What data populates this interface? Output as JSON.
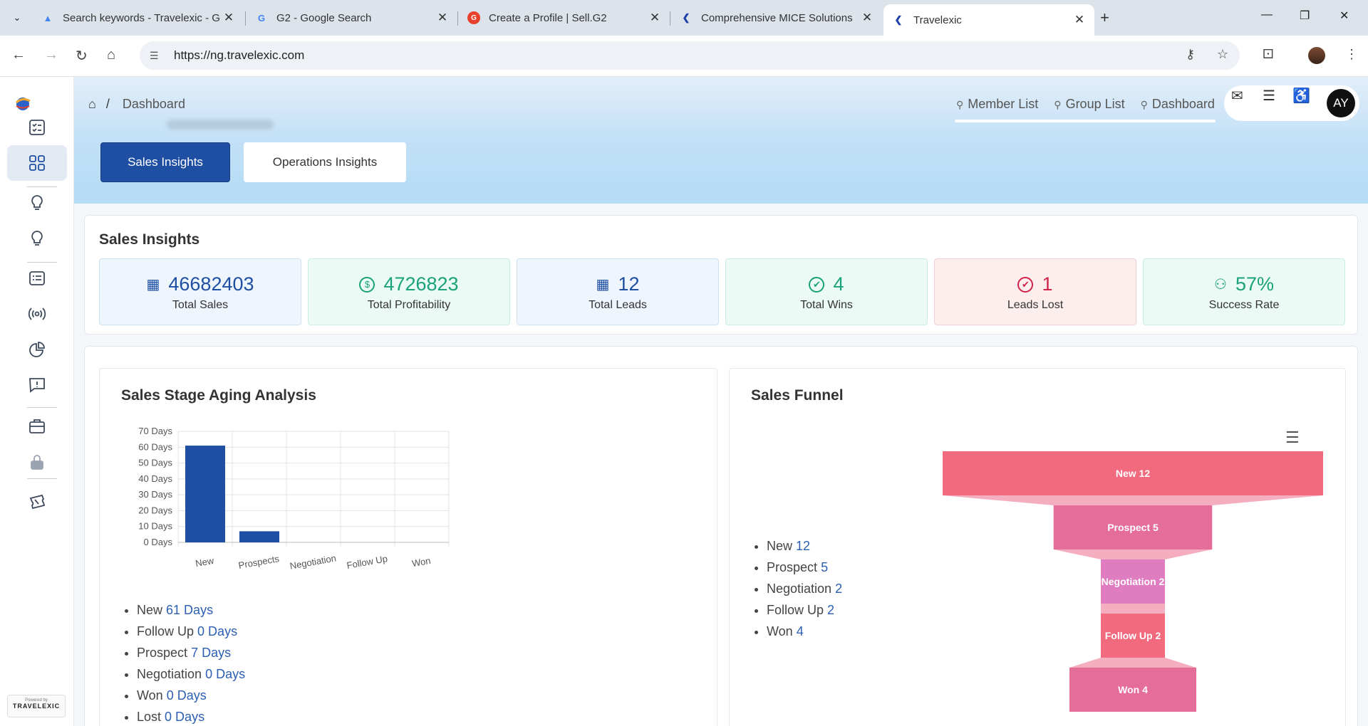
{
  "browser": {
    "tabs": [
      {
        "title": "Search keywords - Travelexic - G",
        "favicon": "google-ads-icon",
        "color": "#4285f4"
      },
      {
        "title": "G2 - Google Search",
        "favicon": "google-icon",
        "color": "#4285f4"
      },
      {
        "title": "Create a Profile | Sell.G2",
        "favicon": "g2-icon",
        "color": "#e8412c"
      },
      {
        "title": "Comprehensive MICE Solutions",
        "favicon": "travelexic-icon",
        "color": "#1d3fa8"
      },
      {
        "title": "Travelexic",
        "favicon": "travelexic-icon",
        "color": "#1d3fa8"
      }
    ],
    "url": "https://ng.travelexic.com"
  },
  "breadcrumb": {
    "current": "Dashboard"
  },
  "quick_links": [
    {
      "label": "Member List"
    },
    {
      "label": "Group List"
    },
    {
      "label": "Dashboard"
    }
  ],
  "user": {
    "initials": "AY"
  },
  "insight_tabs": {
    "sales": "Sales Insights",
    "operations": "Operations Insights"
  },
  "kpis": {
    "title": "Sales Insights",
    "items": [
      {
        "value": "46682403",
        "label": "Total Sales",
        "icon": "chart-badge-icon",
        "color": "#1f4fa3",
        "bg": "#eef5fd",
        "border": "#cfe0f3"
      },
      {
        "value": "4726823",
        "label": "Total Profitability",
        "icon": "dollar-icon",
        "color": "#1aa37a",
        "bg": "#ecfaf5",
        "border": "#c9eee0"
      },
      {
        "value": "12",
        "label": "Total Leads",
        "icon": "chart-badge-icon",
        "color": "#1f4fa3",
        "bg": "#eef5fd",
        "border": "#cfe0f3"
      },
      {
        "value": "4",
        "label": "Total Wins",
        "icon": "check-circle-icon",
        "color": "#1aa37a",
        "bg": "#ecfaf5",
        "border": "#c9eee0"
      },
      {
        "value": "1",
        "label": "Leads Lost",
        "icon": "check-circle-icon",
        "color": "#d0224a",
        "bg": "#fdeeee",
        "border": "#f3d0d4"
      },
      {
        "value": "57%",
        "label": "Success Rate",
        "icon": "users-icon",
        "color": "#1aa37a",
        "bg": "#ecfaf5",
        "border": "#c9eee0"
      }
    ]
  },
  "aging": {
    "title": "Sales Stage Aging Analysis",
    "list": [
      {
        "label": "New",
        "value": "61 Days"
      },
      {
        "label": "Follow Up",
        "value": "0 Days"
      },
      {
        "label": "Prospect",
        "value": "7 Days"
      },
      {
        "label": "Negotiation",
        "value": "0 Days"
      },
      {
        "label": "Won",
        "value": "0 Days"
      },
      {
        "label": "Lost",
        "value": "0 Days"
      }
    ]
  },
  "funnel": {
    "title": "Sales Funnel",
    "list": [
      {
        "label": "New",
        "value": "12"
      },
      {
        "label": "Prospect",
        "value": "5"
      },
      {
        "label": "Negotiation",
        "value": "2"
      },
      {
        "label": "Follow Up",
        "value": "2"
      },
      {
        "label": "Won",
        "value": "4"
      }
    ]
  },
  "chart_data": [
    {
      "type": "bar",
      "categories": [
        "New",
        "Prospects",
        "Negotiation",
        "Follow Up",
        "Won"
      ],
      "values": [
        61,
        7,
        0,
        0,
        0
      ],
      "yticks": [
        "0 Days",
        "10 Days",
        "20 Days",
        "30 Days",
        "40 Days",
        "50 Days",
        "60 Days",
        "70 Days"
      ],
      "ylim": [
        0,
        70
      ],
      "color": "#1f4fa3",
      "grid": true
    },
    {
      "type": "funnel",
      "categories": [
        "New",
        "Prospect",
        "Negotiation",
        "Follow Up",
        "Won"
      ],
      "values": [
        12,
        5,
        2,
        2,
        4
      ],
      "labels": [
        "New 12",
        "Prospect 5",
        "Negotiation 2",
        "Follow Up 2",
        "Won 4"
      ],
      "colors": [
        "#f26a7e",
        "#e56d9a",
        "#e07cc0",
        "#f26a7e",
        "#e56d9a"
      ]
    }
  ]
}
